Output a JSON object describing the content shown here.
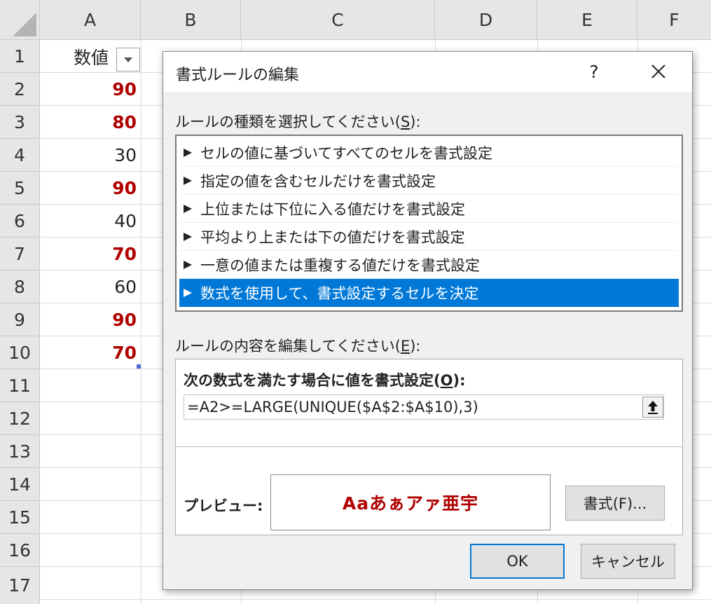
{
  "sheet": {
    "columns": [
      "A",
      "B",
      "C",
      "D",
      "E",
      "F"
    ],
    "rows": [
      "1",
      "2",
      "3",
      "4",
      "5",
      "6",
      "7",
      "8",
      "9",
      "10",
      "11",
      "12",
      "13",
      "14",
      "15",
      "16",
      "17"
    ],
    "header_cell": "数値",
    "values": [
      {
        "text": "90",
        "highlighted": true
      },
      {
        "text": "80",
        "highlighted": true
      },
      {
        "text": "30",
        "highlighted": false
      },
      {
        "text": "90",
        "highlighted": true
      },
      {
        "text": "40",
        "highlighted": false
      },
      {
        "text": "70",
        "highlighted": true
      },
      {
        "text": "60",
        "highlighted": false
      },
      {
        "text": "90",
        "highlighted": true
      },
      {
        "text": "70",
        "highlighted": true
      }
    ],
    "highlight_color": "#b00000"
  },
  "dialog": {
    "title": "書式ルールの編集",
    "help": "?",
    "rule_type_label": "ルールの種類を選択してください(",
    "rule_type_key": "S",
    "rule_type_suffix": "):",
    "rules": [
      {
        "label": "セルの値に基づいてすべてのセルを書式設定",
        "selected": false
      },
      {
        "label": "指定の値を含むセルだけを書式設定",
        "selected": false
      },
      {
        "label": "上位または下位に入る値だけを書式設定",
        "selected": false
      },
      {
        "label": "平均より上または下の値だけを書式設定",
        "selected": false
      },
      {
        "label": "一意の値または重複する値だけを書式設定",
        "selected": false
      },
      {
        "label": "数式を使用して、書式設定するセルを決定",
        "selected": true
      }
    ],
    "selection_color": "#0078d7",
    "edit_label": "ルールの内容を編集してください(",
    "edit_key": "E",
    "edit_suffix": "):",
    "formula_label": "次の数式を満たす場合に値を書式設定(",
    "formula_key": "O",
    "formula_suffix": "):",
    "formula_value": "=A2>=LARGE(UNIQUE($A$2:$A$10),3)",
    "preview_label": "プレビュー:",
    "preview_sample": "Aaあぁアァ亜宇",
    "format_button": "書式(F)...",
    "ok_button": "OK",
    "cancel_button": "キャンセル"
  }
}
